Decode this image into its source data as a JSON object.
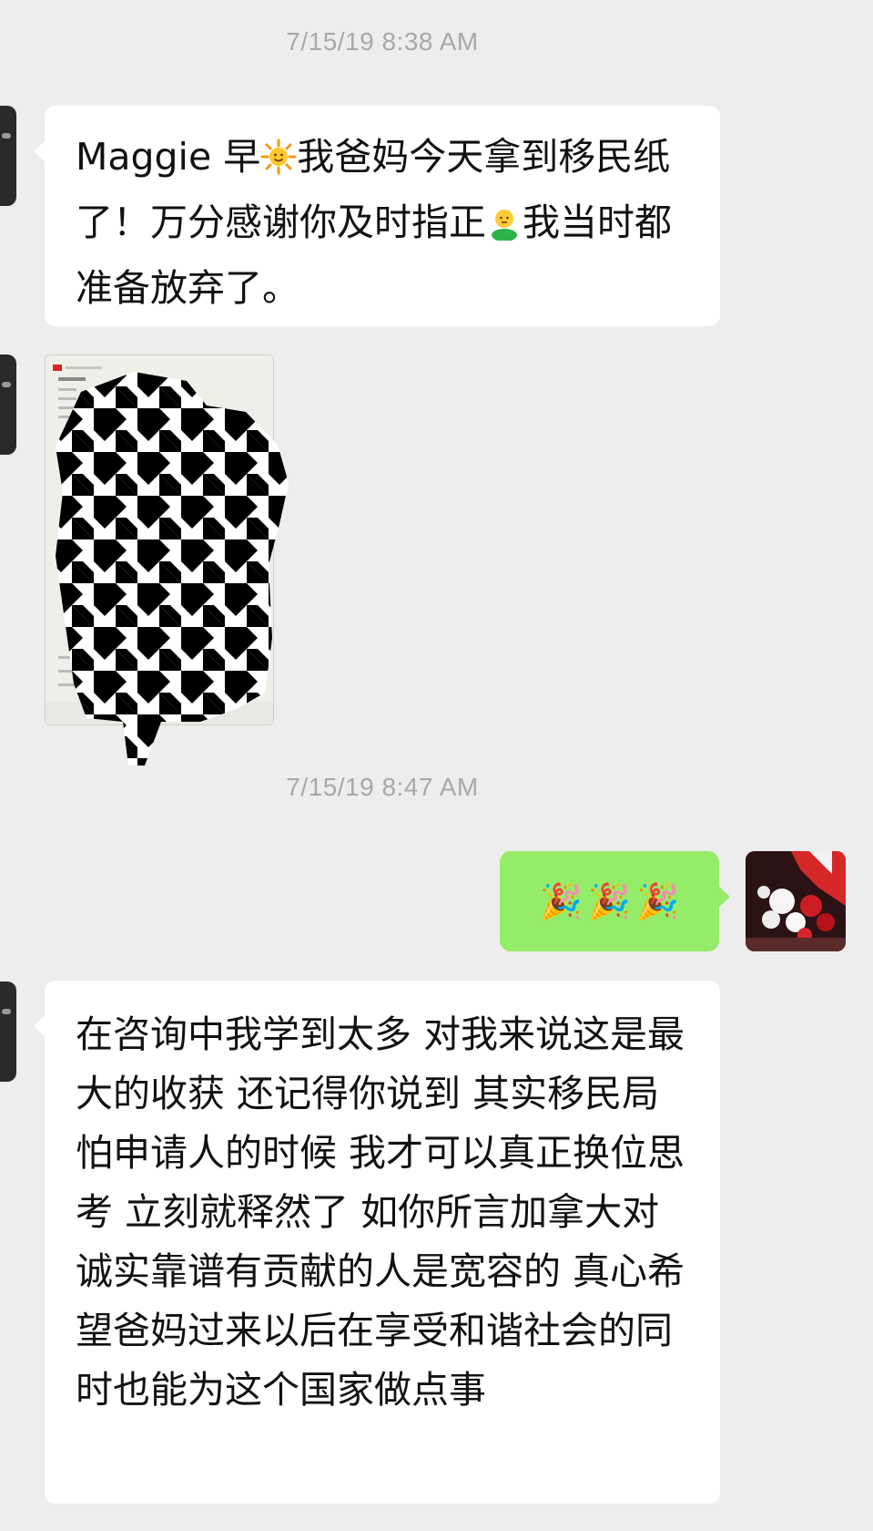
{
  "chat": {
    "timestamps": [
      "7/15/19 8:38 AM",
      "7/15/19 8:47 AM"
    ],
    "messages": [
      {
        "from": "other",
        "type": "text",
        "text_parts": [
          "Maggie 早",
          "我爸妈今天拿到移民纸了！万分感谢你及时指正",
          "我当时都准备放弃了。"
        ],
        "emoji": [
          "sun-emoji",
          "person-emoji"
        ]
      },
      {
        "from": "other",
        "type": "image",
        "description_icon": "redacted-document-image"
      },
      {
        "from": "me",
        "type": "emoji",
        "emoji_glyph": "🎉",
        "emoji_count": 3
      },
      {
        "from": "other",
        "type": "text",
        "text": "在咨询中我学到太多 对我来说这是最大的收获 还记得你说到 其实移民局怕申请人的时候 我才可以真正换位思考 立刻就释然了 如你所言加拿大对诚实靠谱有贡献的人是宽容的 真心希望爸妈过来以后在享受和谐社会的同时也能为这个国家做点事"
      }
    ]
  },
  "colors": {
    "background": "#ededed",
    "incoming_bubble": "#ffffff",
    "outgoing_bubble": "#95ec69",
    "timestamp": "#a8a8a8"
  }
}
